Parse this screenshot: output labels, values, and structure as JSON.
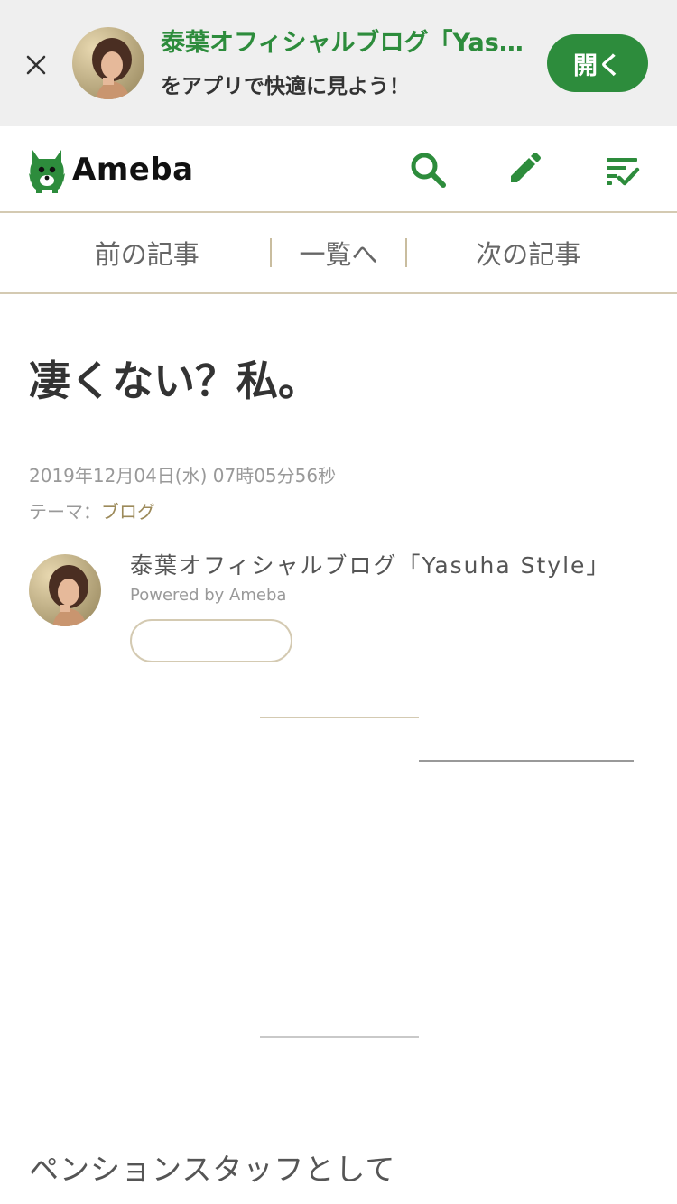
{
  "app_banner": {
    "title": "泰葉オフィシャルブログ「Yas…",
    "subtitle": "をアプリで快適に見よう！",
    "open_label": "開く"
  },
  "header": {
    "logo_text": "Ameba",
    "icons": [
      "search-icon",
      "pencil-icon",
      "reader-list-icon"
    ],
    "brand_color": "#2d8c3c"
  },
  "article_nav": {
    "prev_label": "前の記事",
    "list_label": "一覧へ",
    "next_label": "次の記事"
  },
  "article": {
    "title": "凄くない？私。",
    "date": "2019年12月04日(水) 07時05分56秒",
    "theme_prefix": "テーマ：",
    "theme_link": "ブログ",
    "blog_name": "泰葉オフィシャルブログ「Yasuha Style」",
    "powered_by": "Powered by Ameba",
    "body_first_line": "ペンションスタッフとして"
  }
}
